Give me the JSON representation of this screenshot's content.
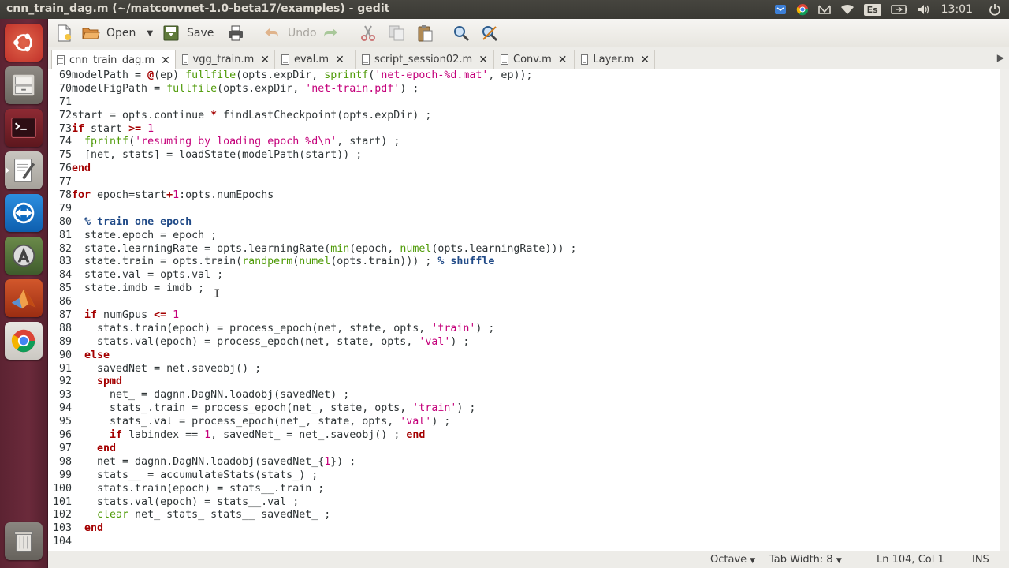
{
  "window": {
    "title": "cnn_train_dag.m (~/matconvnet-1.0-beta17/examples) - gedit"
  },
  "tray": {
    "keyboard": "Es",
    "clock": "13:01"
  },
  "launcher": {
    "items": [
      "ubuntu-dash",
      "files",
      "terminal",
      "text-editor",
      "teamviewer",
      "software-updater",
      "matlab",
      "chrome",
      "trash"
    ]
  },
  "toolbar": {
    "open": "Open",
    "save": "Save",
    "undo": "Undo"
  },
  "tabs": [
    {
      "label": "cnn_train_dag.m"
    },
    {
      "label": "vgg_train.m"
    },
    {
      "label": "eval.m"
    },
    {
      "label": "script_session02.m"
    },
    {
      "label": "Conv.m"
    },
    {
      "label": "Layer.m"
    }
  ],
  "code": {
    "first_line": 69,
    "lines": [
      "modelPath = @(ep) fullfile(opts.expDir, sprintf('net-epoch-%d.mat', ep));",
      "modelFigPath = fullfile(opts.expDir, 'net-train.pdf') ;",
      "",
      "start = opts.continue * findLastCheckpoint(opts.expDir) ;",
      "if start >= 1",
      "  fprintf('resuming by loading epoch %d\\n', start) ;",
      "  [net, stats] = loadState(modelPath(start)) ;",
      "end",
      "",
      "for epoch=start+1:opts.numEpochs",
      "",
      "  % train one epoch",
      "  state.epoch = epoch ;",
      "  state.learningRate = opts.learningRate(min(epoch, numel(opts.learningRate))) ;",
      "  state.train = opts.train(randperm(numel(opts.train))) ; % shuffle",
      "  state.val = opts.val ;",
      "  state.imdb = imdb ;",
      "",
      "  if numGpus <= 1",
      "    stats.train(epoch) = process_epoch(net, state, opts, 'train') ;",
      "    stats.val(epoch) = process_epoch(net, state, opts, 'val') ;",
      "  else",
      "    savedNet = net.saveobj() ;",
      "    spmd",
      "      net_ = dagnn.DagNN.loadobj(savedNet) ;",
      "      stats_.train = process_epoch(net_, state, opts, 'train') ;",
      "      stats_.val = process_epoch(net_, state, opts, 'val') ;",
      "      if labindex == 1, savedNet_ = net_.saveobj() ; end",
      "    end",
      "    net = dagnn.DagNN.loadobj(savedNet_{1}) ;",
      "    stats__ = accumulateStats(stats_) ;",
      "    stats.train(epoch) = stats__.train ;",
      "    stats.val(epoch) = stats__.val ;",
      "    clear net_ stats_ stats__ savedNet_ ;",
      "  end",
      ""
    ]
  },
  "status": {
    "language": "Octave",
    "tab_width": "Tab Width: 8",
    "position": "Ln 104, Col 1",
    "mode": "INS"
  }
}
